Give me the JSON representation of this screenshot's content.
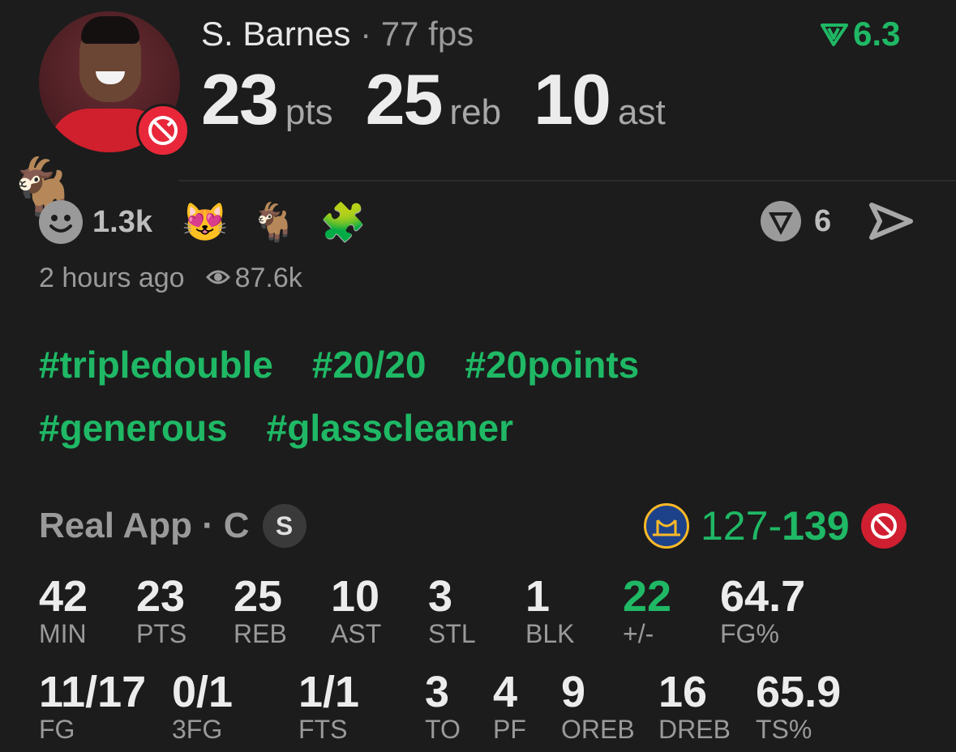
{
  "player": {
    "name": "S. Barnes",
    "separator": "·",
    "fps": "77 fps",
    "rating": "6.3"
  },
  "headline": [
    {
      "value": "23",
      "unit": "pts"
    },
    {
      "value": "25",
      "unit": "reb"
    },
    {
      "value": "10",
      "unit": "ast"
    }
  ],
  "reactions": {
    "count": "1.3k",
    "emojis": [
      "😻",
      "🐐",
      "🧩"
    ],
    "big_emoji": "🐐",
    "comments": "6"
  },
  "meta": {
    "time": "2 hours ago",
    "views": "87.6k"
  },
  "tags": [
    "#tripledouble",
    "#20/20",
    "#20points",
    "#generous",
    "#glasscleaner"
  ],
  "source": {
    "label": "Real App",
    "separator": "·",
    "position": "C",
    "badge": "S"
  },
  "score": {
    "away": "127",
    "dash": "-",
    "home": "139"
  },
  "stats_row1": [
    {
      "value": "42",
      "label": "MIN"
    },
    {
      "value": "23",
      "label": "PTS"
    },
    {
      "value": "25",
      "label": "REB"
    },
    {
      "value": "10",
      "label": "AST"
    },
    {
      "value": "3",
      "label": "STL"
    },
    {
      "value": "1",
      "label": "BLK"
    },
    {
      "value": "22",
      "label": "+/-"
    },
    {
      "value": "64.7",
      "label": "FG%"
    }
  ],
  "stats_row2": [
    {
      "value": "11/17",
      "label": "FG"
    },
    {
      "value": "0/1",
      "label": "3FG"
    },
    {
      "value": "1/1",
      "label": "FTS"
    },
    {
      "value": "3",
      "label": "TO"
    },
    {
      "value": "4",
      "label": "PF"
    },
    {
      "value": "9",
      "label": "OREB"
    },
    {
      "value": "16",
      "label": "DREB"
    },
    {
      "value": "65.9",
      "label": "TS%"
    }
  ],
  "colors": {
    "accent": "#1fb865",
    "background": "#1c1c1c",
    "muted": "#9a9a9a"
  }
}
